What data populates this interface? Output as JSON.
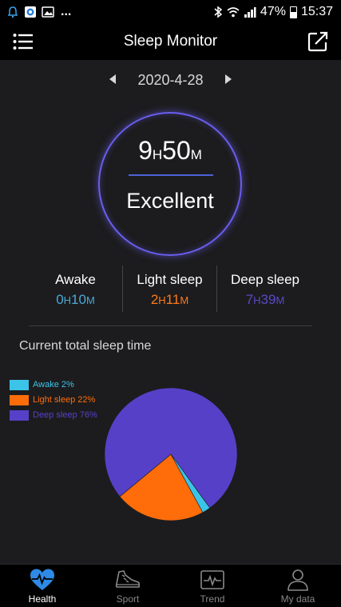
{
  "status_bar": {
    "battery": "47%",
    "time": "15:37",
    "notification_dots": "..."
  },
  "header": {
    "title": "Sleep Monitor",
    "menu_icon": "menu-icon",
    "edit_icon": "edit-external-icon"
  },
  "date_nav": {
    "date": "2020-4-28"
  },
  "summary": {
    "hours": "9",
    "hours_unit": "H",
    "minutes": "50",
    "minutes_unit": "M",
    "quality": "Excellent",
    "ring_color": "#6a5ef0"
  },
  "stats": [
    {
      "label": "Awake",
      "hours": "0",
      "minutes": "10",
      "color": "#4aa8d8"
    },
    {
      "label": "Light sleep",
      "hours": "2",
      "minutes": "11",
      "color": "#ff7a1a"
    },
    {
      "label": "Deep sleep",
      "hours": "7",
      "minutes": "39",
      "color": "#5b48c8"
    }
  ],
  "units": {
    "h": "H",
    "m": "M"
  },
  "chart_section": {
    "title": "Current total sleep time"
  },
  "chart_data": {
    "type": "pie",
    "categories": [
      "Awake",
      "Light sleep",
      "Deep sleep"
    ],
    "values": [
      2,
      22,
      76
    ],
    "legend": [
      "Awake 2%",
      "Light sleep 22%",
      "Deep sleep 76%"
    ],
    "colors": [
      "#3cc4e8",
      "#ff6d0a",
      "#5740c8"
    ],
    "legend_position": "top-left"
  },
  "bottom_nav": [
    {
      "label": "Health",
      "icon": "heart-pulse-icon",
      "active": true
    },
    {
      "label": "Sport",
      "icon": "shoe-icon",
      "active": false
    },
    {
      "label": "Trend",
      "icon": "trend-chart-icon",
      "active": false
    },
    {
      "label": "My data",
      "icon": "person-icon",
      "active": false
    }
  ]
}
